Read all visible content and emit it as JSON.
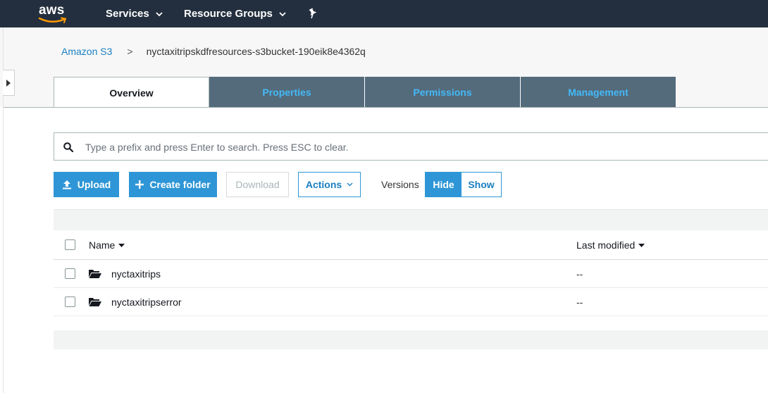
{
  "topbar": {
    "logo_text": "aws",
    "services_label": "Services",
    "resource_groups_label": "Resource Groups"
  },
  "breadcrumb": {
    "root": "Amazon S3",
    "separator": ">",
    "current": "nyctaxitripskdfresources-s3bucket-190eik8e4362q"
  },
  "tabs": [
    {
      "label": "Overview",
      "active": true
    },
    {
      "label": "Properties",
      "active": false
    },
    {
      "label": "Permissions",
      "active": false
    },
    {
      "label": "Management",
      "active": false
    }
  ],
  "search": {
    "placeholder": "Type a prefix and press Enter to search. Press ESC to clear.",
    "value": ""
  },
  "toolbar": {
    "upload_label": "Upload",
    "create_folder_label": "Create folder",
    "download_label": "Download",
    "actions_label": "Actions",
    "versions_label": "Versions",
    "hide_label": "Hide",
    "show_label": "Show"
  },
  "table": {
    "columns": [
      "Name",
      "Last modified"
    ],
    "rows": [
      {
        "name": "nyctaxitrips",
        "last_modified": "--"
      },
      {
        "name": "nyctaxitripserror",
        "last_modified": "--"
      }
    ]
  },
  "colors": {
    "topbar": "#232f3e",
    "primary": "#2e96d6",
    "tab_inactive_bg": "#546b7b",
    "tab_inactive_text": "#44b9f7",
    "link": "#1a7fc1"
  },
  "icons": [
    "aws-smile-icon",
    "chevron-down-icon",
    "pin-icon",
    "expand-arrow-icon",
    "search-icon",
    "upload-icon",
    "plus-icon",
    "sort-caret-icon",
    "folder-icon"
  ]
}
